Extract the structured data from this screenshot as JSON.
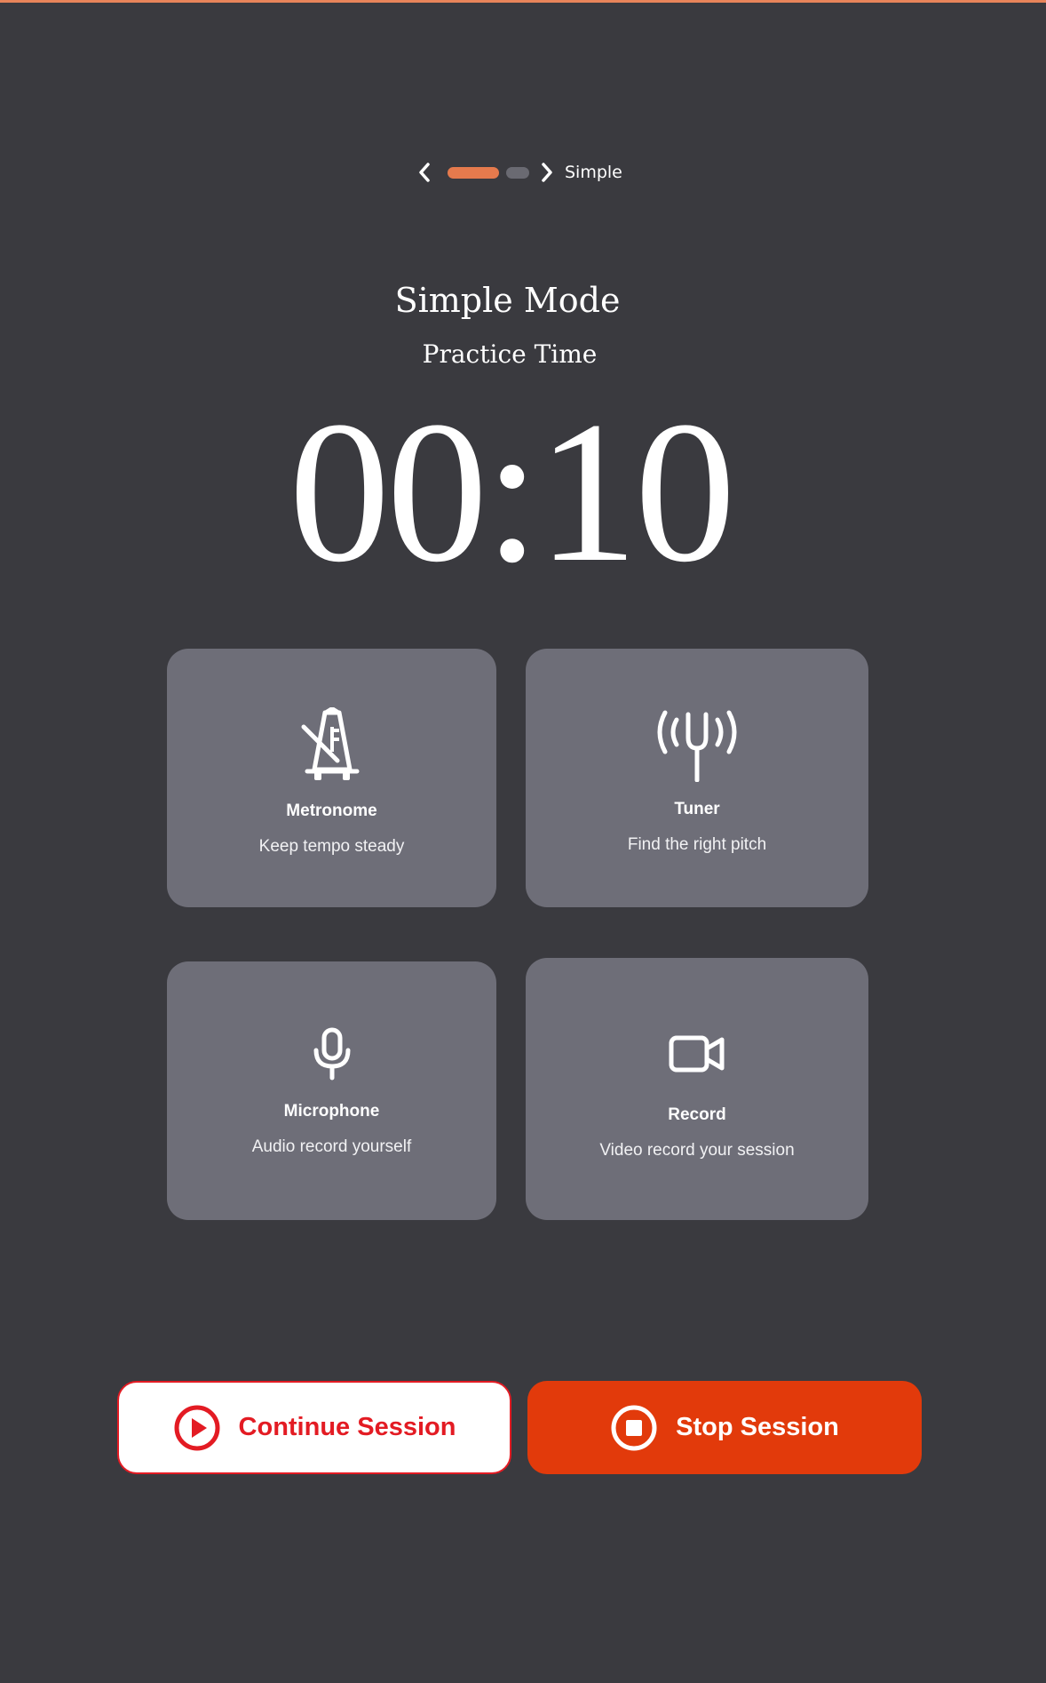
{
  "colors": {
    "background": "#3a3a3f",
    "accent": "#e57a4d",
    "card": "#6e6e78",
    "continue": "#e31b23",
    "stop": "#e23a0b"
  },
  "pager": {
    "prev_icon": "chevron-left-icon",
    "next_icon": "chevron-right-icon",
    "label": "Simple",
    "pages": 2,
    "active_page": 1
  },
  "header": {
    "title": "Simple Mode",
    "subtitle": "Practice Time"
  },
  "timer": {
    "value": "00:10"
  },
  "tools": [
    {
      "name": "Metronome",
      "description": "Keep tempo steady",
      "icon": "metronome-off-icon"
    },
    {
      "name": "Tuner",
      "description": "Find the right pitch",
      "icon": "tuning-fork-icon"
    },
    {
      "name": "Microphone",
      "description": "Audio record yourself",
      "icon": "microphone-icon"
    },
    {
      "name": "Record",
      "description": "Video record your session",
      "icon": "video-camera-icon"
    }
  ],
  "actions": {
    "continue_label": "Continue Session",
    "continue_icon": "play-circle-icon",
    "stop_label": "Stop Session",
    "stop_icon": "stop-circle-icon"
  }
}
